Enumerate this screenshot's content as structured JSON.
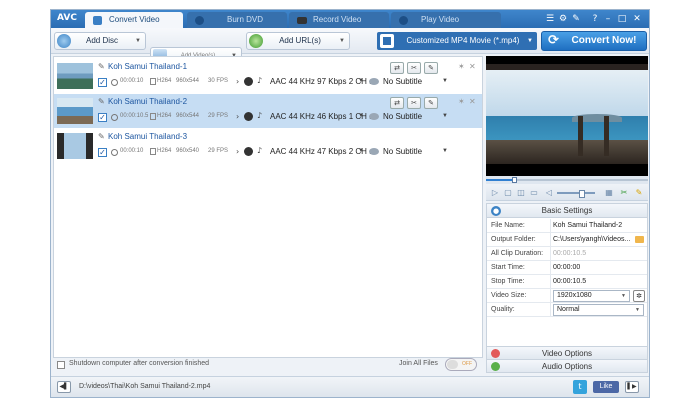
{
  "app": {
    "logo": "AVC"
  },
  "tabs": [
    {
      "label": "Convert Video",
      "active": true
    },
    {
      "label": "Burn DVD",
      "active": false
    },
    {
      "label": "Record Video",
      "active": false
    },
    {
      "label": "Play Video",
      "active": false
    }
  ],
  "window_controls": {
    "menu": "☰",
    "settings": "⚙",
    "tools": "✎",
    "help": "?",
    "minimize": "–",
    "maximize": "□",
    "close": "✕"
  },
  "toolbar": {
    "add_disc": "Add Disc",
    "add_videos": "Add Video(s)",
    "add_urls": "Add URL(s)",
    "format": "Customized MP4 Movie (*.mp4)",
    "convert": "Convert Now!",
    "convert_icon": "⟳"
  },
  "files": [
    {
      "name": "Koh Samui Thailand-1",
      "duration": "00:00:10",
      "codec": "H264",
      "resolution": "960x544",
      "fps": "30 FPS",
      "audio": "AAC 44 KHz 97 Kbps 2 CH ...",
      "subtitle": "No Subtitle",
      "selected": false
    },
    {
      "name": "Koh Samui Thailand-2",
      "duration": "00:00:10.5",
      "codec": "H264",
      "resolution": "960x544",
      "fps": "29 FPS",
      "audio": "AAC 44 KHz 46 Kbps 1 CH ...",
      "subtitle": "No Subtitle",
      "selected": true
    },
    {
      "name": "Koh Samui Thailand-3",
      "duration": "00:00:10",
      "codec": "H264",
      "resolution": "960x540",
      "fps": "29 FPS",
      "audio": "AAC 44 KHz 47 Kbps 2 CH ...",
      "subtitle": "No Subtitle",
      "selected": false
    }
  ],
  "row_icons": {
    "pencil": "✎",
    "check": "✓",
    "arrow": "›",
    "speaker": "♪",
    "effects": "⇄",
    "trim": "✂",
    "crop": "✎",
    "star": "✶",
    "remove": "✕"
  },
  "list_footer": {
    "shutdown": "Shutdown computer after conversion finished",
    "join": "Join All Files",
    "toggle": "OFF"
  },
  "player_icons": {
    "play": "▷",
    "stop": "▢",
    "snapshot": "◫",
    "folder": "▭",
    "volume": "◁",
    "fullscreen": "▦",
    "split": "✂",
    "tools": "✎"
  },
  "playback_progress": 0.17,
  "volume_level": 0.6,
  "settings": {
    "title": "Basic Settings",
    "icon": "●",
    "rows": [
      {
        "label": "File Name:",
        "value": "Koh Samui Thailand-2"
      },
      {
        "label": "Output Folder:",
        "value": "C:\\Users\\yangh\\Videos..."
      },
      {
        "label": "All Clip Duration:",
        "value": "00:00:10.5"
      },
      {
        "label": "Start Time:",
        "value": "00:00:00"
      },
      {
        "label": "Stop Time:",
        "value": "00:00:10.5"
      },
      {
        "label": "Video Size:",
        "value": "1920x1080"
      },
      {
        "label": "Quality:",
        "value": "Normal"
      }
    ],
    "gear": "✲",
    "video_options": "Video Options",
    "audio_options": "Audio Options"
  },
  "status": {
    "path": "D:\\videos\\Thai\\Koh Samui Thailand-2.mp4",
    "twitter": "t",
    "facebook": "Like",
    "left_btn": "◀▌",
    "right_btn": "▌▶"
  }
}
